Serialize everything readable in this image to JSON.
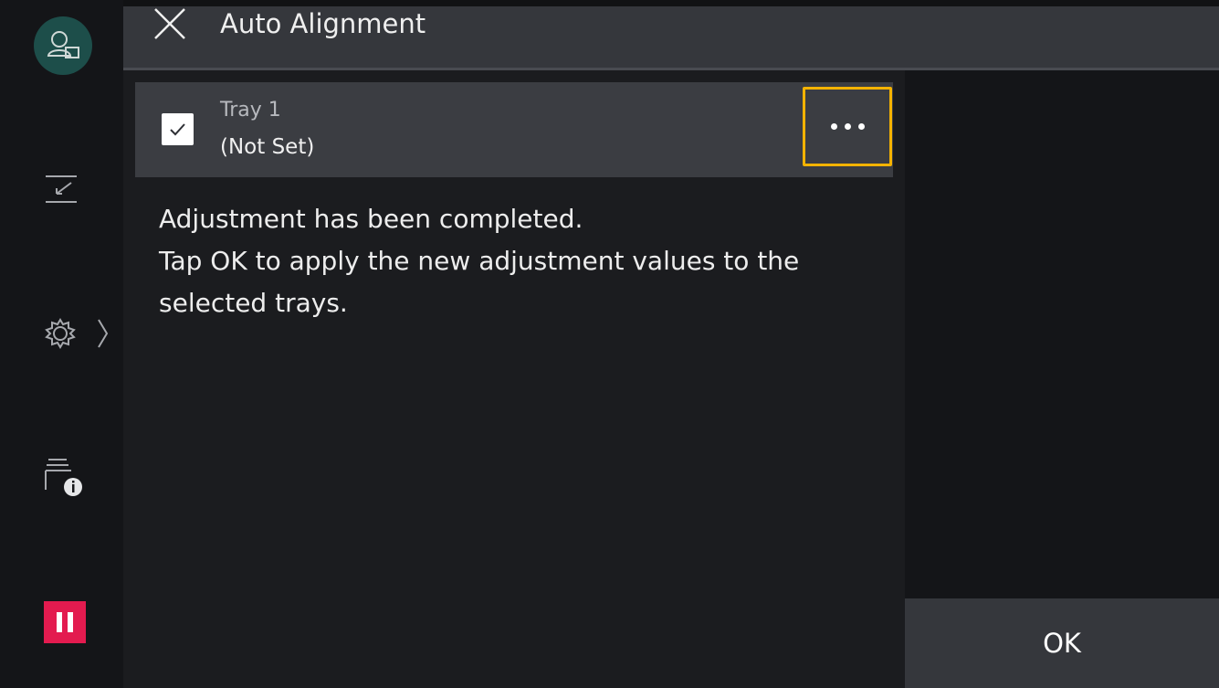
{
  "header": {
    "title": "Auto Alignment",
    "close_icon": "close-icon"
  },
  "tray": {
    "name": "Tray 1",
    "status": "(Not Set)",
    "checked": true
  },
  "message": {
    "lines": [
      "Adjustment has been completed.",
      "Tap OK to apply the new adjustment values to the",
      "selected trays."
    ]
  },
  "actions": {
    "ok_label": "OK"
  },
  "sidebar": {
    "icons": [
      "user-icon",
      "swap-icon",
      "gear-icon",
      "job-status-icon",
      "pause-icon"
    ]
  },
  "colors": {
    "highlight": "#f5b300",
    "pause": "#e31b4f",
    "avatar": "#1d4e4a"
  }
}
